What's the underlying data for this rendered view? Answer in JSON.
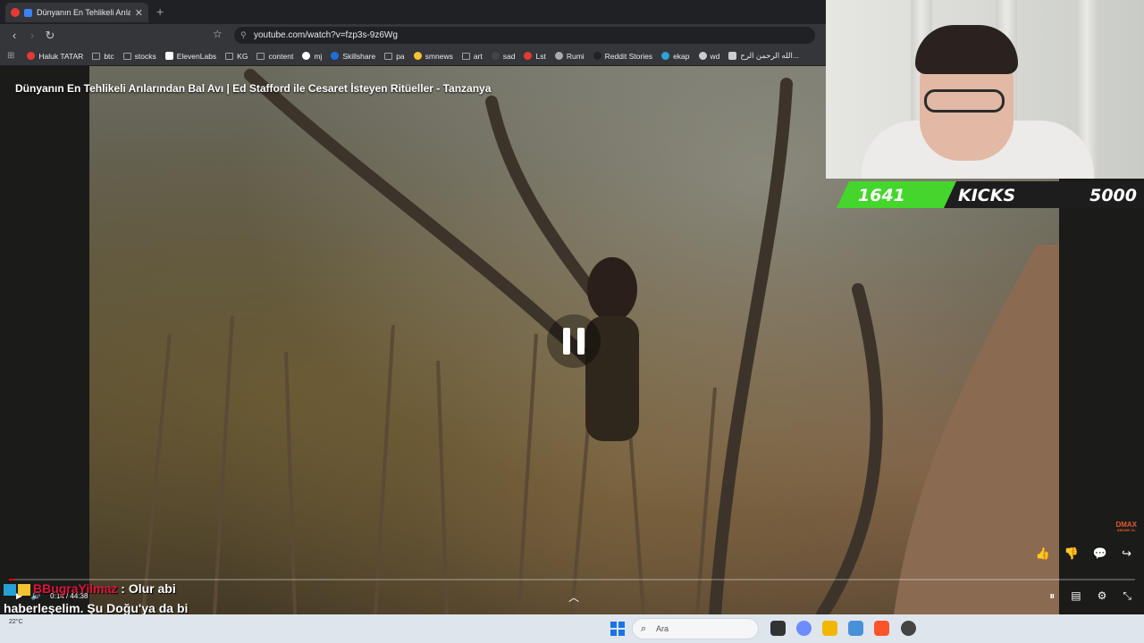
{
  "browser": {
    "tab_title": "Dünyanın En Tehlikeli Arılarını...",
    "tab_close": "✕",
    "new_tab": "+",
    "url": "youtube.com/watch?v=fzp3s-9z6Wg",
    "back_icon": "‹",
    "forward_icon": "›",
    "reload_icon": "↻",
    "bookmark_icon": "☆"
  },
  "bookmarks": [
    {
      "label": "Haluk TATAR",
      "icon": "youtube",
      "color": "#e53935"
    },
    {
      "label": "btc",
      "icon": "folder"
    },
    {
      "label": "stocks",
      "icon": "folder"
    },
    {
      "label": "ElevenLabs",
      "icon": "square",
      "color": "#ffffff"
    },
    {
      "label": "KG",
      "icon": "folder"
    },
    {
      "label": "content",
      "icon": "folder"
    },
    {
      "label": "mj",
      "icon": "circle",
      "color": "#ffffff"
    },
    {
      "label": "Skillshare",
      "icon": "circle",
      "color": "#1e6fdc"
    },
    {
      "label": "pa",
      "icon": "folder"
    },
    {
      "label": "smnews",
      "icon": "circle",
      "color": "#f4c430"
    },
    {
      "label": "art",
      "icon": "folder"
    },
    {
      "label": "sad",
      "icon": "circle",
      "color": "#444444"
    },
    {
      "label": "Lst",
      "icon": "circle",
      "color": "#e53935"
    },
    {
      "label": "Rumi",
      "icon": "circle",
      "color": "#aaaaaa"
    },
    {
      "label": "Reddit Stories",
      "icon": "circle",
      "color": "#222222"
    },
    {
      "label": "ekap",
      "icon": "circle",
      "color": "#2fa3d8"
    },
    {
      "label": "wd",
      "icon": "circle",
      "color": "#cccccc"
    },
    {
      "label": "الله الرحمن الرح...",
      "icon": "square",
      "color": "#cccccc"
    }
  ],
  "video": {
    "title": "Dünyanın En Tehlikeli Arılarından Bal Avı | Ed Stafford ile Cesaret İsteyen Ritüeller - Tanzanya",
    "current_time": "0:14",
    "duration": "44:38",
    "progress": 0.005,
    "actions": [
      "👍",
      "👎",
      "💬",
      "↪"
    ],
    "controls_right": [
      "⏸",
      "▤",
      "⚙",
      "⤡"
    ],
    "expand_icon": "︿",
    "watermark": "DMAX",
    "watermark_sub": "ABONE OL"
  },
  "kicks": {
    "count": "1641",
    "label": "KICKS",
    "goal": "5000",
    "green": "#44d62c"
  },
  "chat": {
    "username": "BBugraYilmaz",
    "message": " : Olur abi haberleşelim. Şu Doğu'ya da bi oynatabilirsek"
  },
  "taskbar": {
    "weather": "22°C",
    "search_placeholder": "Ara"
  }
}
